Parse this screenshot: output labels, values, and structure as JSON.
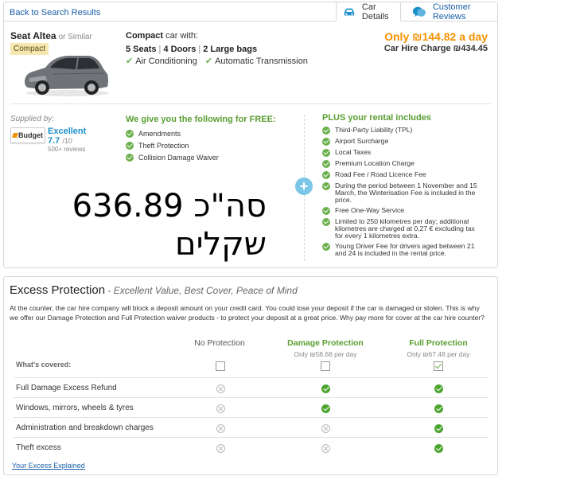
{
  "nav": {
    "back_label": "Back to Search Results",
    "tab_car_details": "Car Details",
    "tab_customer_reviews": "Customer Reviews"
  },
  "car": {
    "name": "Seat Altea",
    "or_similar": "or Similar",
    "category": "Compact",
    "spec_category": "Compact",
    "spec_suffix": "car with:",
    "seats": "5 Seats",
    "doors": "4 Doors",
    "bags": "2 Large bags",
    "feature_1": "Air Conditioning",
    "feature_2": "Automatic Transmission"
  },
  "price": {
    "per_day": "Only ₪144.82 a day",
    "total": "Car Hire Charge ₪434.45"
  },
  "supplier": {
    "label": "Supplied by:",
    "logo_text": "Budget",
    "rating_word": "Excellent",
    "score": "7.7",
    "out_of": "/10",
    "reviews": "500+ reviews"
  },
  "free": {
    "title": "We give you the following for FREE:",
    "items": [
      "Amendments",
      "Theft Protection",
      "Collision Damage Waiver"
    ]
  },
  "plus": {
    "title": "PLUS your rental includes",
    "items": [
      "Third-Party Liability (TPL)",
      "Airport Surcharge",
      "Local Taxes",
      "Premium Location Charge",
      "Road Fee / Road Licence Fee",
      "During the period between 1 November and 15 March, the Winterisation Fee is included in the price.",
      "Free One-Way Service",
      "Limited to 250 kilometres per day; additional kilometres are charged at 0,27 € excluding tax for every 1 kilometres extra.",
      "Young Driver Fee for drivers aged between 21 and 24 is included in the rental price."
    ]
  },
  "overlay": {
    "line1": "סה\"כ 636.89",
    "line2": "שקלים"
  },
  "excess": {
    "title": "Excess Protection",
    "subtitle": " - Excellent Value, Best Cover, Peace of Mind",
    "description": "At the counter, the car hire company will block a deposit amount on your credit card. You could lose your deposit if the car is damaged or stolen. This is why we offer our Damage Protection and Full Protection waiver products - to protect your deposit at a great price. Why pay more for cover at the car hire counter?",
    "col_none": "No Protection",
    "col_damage": "Damage Protection",
    "col_damage_price": "Only ₪58.68 per day",
    "col_full": "Full Protection",
    "col_full_price": "Only ₪67.48 per day",
    "covered_label": "What's covered:",
    "rows": [
      "Full Damage Excess Refund",
      "Windows, mirrors, wheels & tyres",
      "Administration and breakdown charges",
      "Theft excess"
    ],
    "link": "Your Excess Explained"
  }
}
